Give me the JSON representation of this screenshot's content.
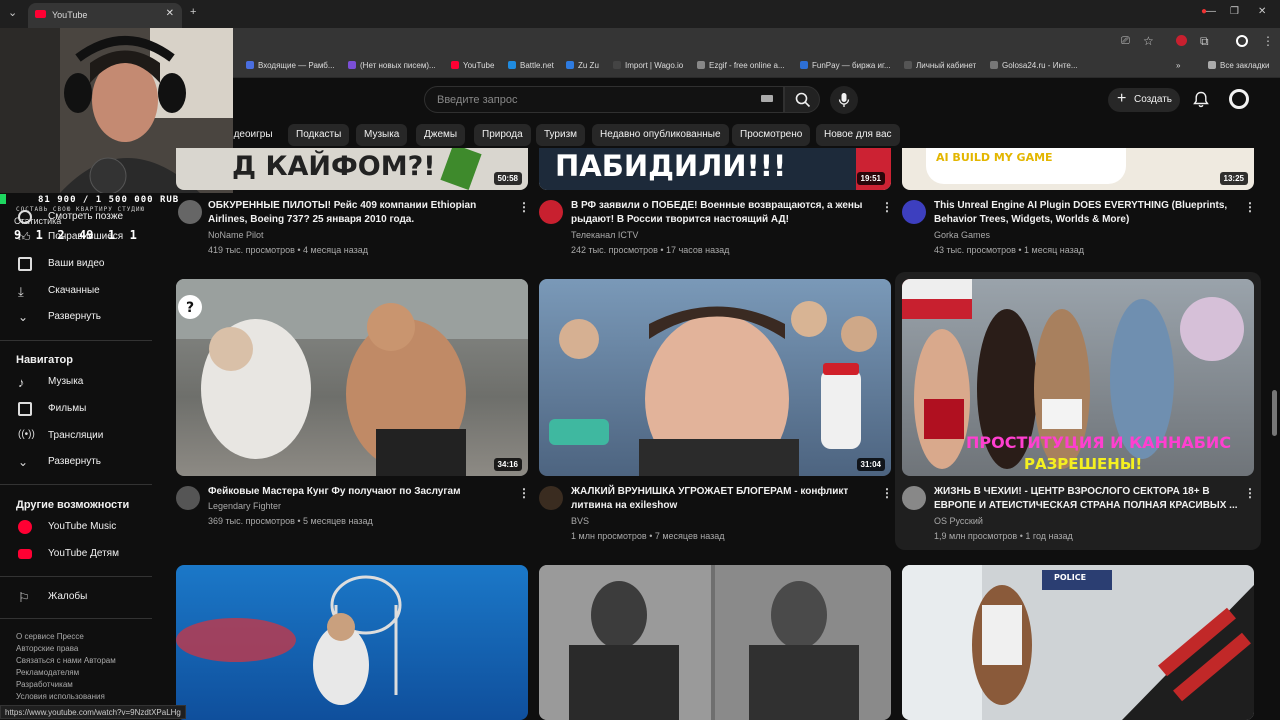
{
  "browser": {
    "tab_title": "YouTube",
    "new_tab": "+",
    "bookmarks": [
      {
        "label": "Входящие — Рамб...",
        "color": "#4a6ee0"
      },
      {
        "label": "(Нет новых писем)...",
        "color": "#7b4fd6"
      },
      {
        "label": "YouTube",
        "color": "#ff0033"
      },
      {
        "label": "Battle.net",
        "color": "#1f8be0"
      },
      {
        "label": "Zu Zu",
        "color": "#2e7be0"
      },
      {
        "label": "Import | Wago.io",
        "color": "#222222"
      },
      {
        "label": "Ezgif - free online a...",
        "color": "#888888"
      },
      {
        "label": "FunPay — биржа иг...",
        "color": "#2d6fd6"
      },
      {
        "label": "Личный кабинет",
        "color": "#555555"
      },
      {
        "label": "Golosa24.ru - Инте...",
        "color": "#777777"
      }
    ],
    "all_bookmarks": "Все закладки",
    "status_url": "https://www.youtube.com/watch?v=9NzdtXPaLHg"
  },
  "header": {
    "search_placeholder": "Введите запрос",
    "create_label": "Создать"
  },
  "chips": [
    "идеоигры",
    "Подкасты",
    "Музыка",
    "Джемы",
    "Природа",
    "Туризм",
    "Недавно опубликованные",
    "Просмотрено",
    "Новое для вас"
  ],
  "overlay": {
    "line1": "81 900 / 1 500 000 RUB",
    "line2": "СОСТАВЬ СВОЮ КВАРТИРУ СТУДИЮ",
    "stats": "9  1  2  49  1  1",
    "stats_label": "Статистика"
  },
  "sidebar": {
    "you_items": [
      {
        "label": "Смотреть позже",
        "icon": "clock-icon"
      },
      {
        "label": "Понравившиеся",
        "icon": "thumb-up-icon"
      },
      {
        "label": "Ваши видео",
        "icon": "video-icon"
      },
      {
        "label": "Скачанные",
        "icon": "download-icon"
      },
      {
        "label": "Развернуть",
        "icon": "chevron-down-icon"
      }
    ],
    "nav_title": "Навигатор",
    "nav_items": [
      {
        "label": "Музыка",
        "icon": "music-icon"
      },
      {
        "label": "Фильмы",
        "icon": "film-icon"
      },
      {
        "label": "Трансляции",
        "icon": "live-icon"
      },
      {
        "label": "Развернуть",
        "icon": "chevron-down-icon"
      }
    ],
    "more_title": "Другие возможности",
    "more_items": [
      {
        "label": "YouTube Music",
        "icon": "youtube-music-icon"
      },
      {
        "label": "YouTube Детям",
        "icon": "youtube-kids-icon"
      }
    ],
    "report_label": "Жалобы",
    "footer": [
      "О сервисе  Прессе",
      "Авторские права",
      "Связаться с нами  Авторам",
      "Рекламодателям",
      "Разработчикам",
      "Условия использования"
    ]
  },
  "videos_row1": [
    {
      "thumb_text": "Д КАЙФОМ?!",
      "duration": "50:58",
      "title": "ОБКУРЕННЫЕ ПИЛОТЫ! Рейс 409 компании Ethiopian Airlines, Boeing 737? 25 января 2010 года.",
      "channel": "NoName Pilot",
      "meta": "419 тыс. просмотров • 4 месяца назад"
    },
    {
      "thumb_text": "ПАБИДИЛИ!!!",
      "duration": "19:51",
      "title": "В РФ заявили о ПОБЕДЕ! Военные возвращаются, а жены рыдают! В России творится настоящий АД!",
      "channel": "Телеканал ICTV",
      "meta": "242 тыс. просмотров • 17 часов назад"
    },
    {
      "thumb_text": "AI BUILD MY GAME",
      "duration": "13:25",
      "title": "This Unreal Engine AI Plugin DOES EVERYTHING (Blueprints, Behavior Trees, Widgets, Worlds & More)",
      "channel": "Gorka Games",
      "meta": "43 тыс. просмотров • 1 месяц назад"
    }
  ],
  "videos_row2": [
    {
      "duration": "34:16",
      "title": "Фейковые Мастера Кунг Фу получают по Заслугам",
      "channel": "Legendary Fighter",
      "meta": "369 тыс. просмотров • 5 месяцев назад"
    },
    {
      "duration": "31:04",
      "title": "ЖАЛКИЙ ВРУНИШКА УГРОЖАЕТ БЛОГЕРАМ - конфликт литвина на exileshow",
      "channel": "BVS",
      "meta": "1 млн просмотров • 7 месяцев назад"
    },
    {
      "thumb_text_1": "ПРОСТИТУЦИЯ И КАННАБИС",
      "thumb_text_2": "РАЗРЕШЕНЫ!",
      "title": "ЖИЗНЬ В ЧЕХИИ! - ЦЕНТР ВЗРОСЛОГО СЕКТОРА 18+ В ЕВРОПЕ И АТЕИСТИЧЕСКАЯ СТРАНА ПОЛНАЯ КРАСИВЫХ ...",
      "channel": "OS Русский",
      "meta": "1,9 млн просмотров • 1 год назад"
    }
  ],
  "row3_thumb_text": "POLICE"
}
